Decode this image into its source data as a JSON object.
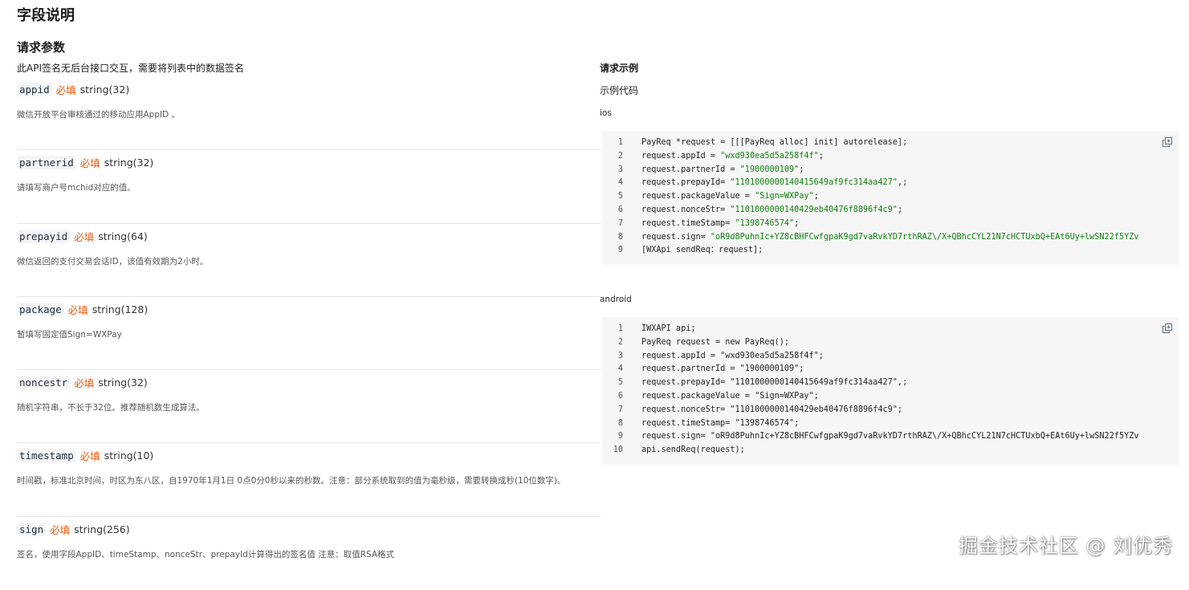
{
  "page_title": "字段说明",
  "request_params": {
    "title": "请求参数",
    "desc": "此API签名无后台接口交互，需要将列表中的数据签名",
    "items": [
      {
        "name": "appid",
        "required": "必填",
        "type": "string(32)",
        "desc": "微信开放平台审核通过的移动应用AppID 。"
      },
      {
        "name": "partnerid",
        "required": "必填",
        "type": "string(32)",
        "desc": "请填写商户号mchid对应的值。"
      },
      {
        "name": "prepayid",
        "required": "必填",
        "type": "string(64)",
        "desc": "微信返回的支付交易会话ID，该值有效期为2小时。"
      },
      {
        "name": "package",
        "required": "必填",
        "type": "string(128)",
        "desc": "暂填写固定值Sign=WXPay"
      },
      {
        "name": "noncestr",
        "required": "必填",
        "type": "string(32)",
        "desc": "随机字符串，不长于32位。推荐随机数生成算法。"
      },
      {
        "name": "timestamp",
        "required": "必填",
        "type": "string(10)",
        "desc": "时间戳，标准北京时间，时区为东八区，自1970年1月1日 0点0分0秒以来的秒数。注意：部分系统取到的值为毫秒级，需要转换成秒(10位数字)。"
      },
      {
        "name": "sign",
        "required": "必填",
        "type": "string(256)",
        "desc": "签名，使用字段AppID、timeStamp、nonceStr、prepayId计算得出的签名值 注意：取值RSA格式"
      }
    ]
  },
  "request_example": {
    "title": "请求示例",
    "subtitle": "示例代码",
    "blocks": [
      {
        "platform": "ios",
        "lines": [
          {
            "n": "1",
            "code": "PayReq *request = [[[PayReq alloc] init] autorelease];",
            "pre": "",
            "str": "",
            "post": ""
          },
          {
            "n": "2",
            "code": "",
            "pre": "request.appId = ",
            "str": "\"wxd930ea5d5a258f4f\"",
            "post": ";"
          },
          {
            "n": "3",
            "code": "",
            "pre": "request.partnerId = ",
            "str": "\"1900000109\"",
            "post": ";"
          },
          {
            "n": "4",
            "code": "",
            "pre": "request.prepayId= ",
            "str": "\"1101000000140415649af9fc314aa427\"",
            "post": ",;"
          },
          {
            "n": "5",
            "code": "",
            "pre": "request.packageValue = ",
            "str": "\"Sign=WXPay\"",
            "post": ";"
          },
          {
            "n": "6",
            "code": "",
            "pre": "request.nonceStr= ",
            "str": "\"1101000000140429eb40476f8896f4c9\"",
            "post": ";"
          },
          {
            "n": "7",
            "code": "",
            "pre": "request.timeStamp= ",
            "str": "\"1398746574\"",
            "post": ";"
          },
          {
            "n": "8",
            "code": "",
            "pre": "request.sign= ",
            "str": "\"oR9d8PuhnIc+YZ8cBHFCwfgpaK9gd7vaRvkYD7rthRAZ\\/X+QBhcCYL21N7cHCTUxbQ+EAt6Uy+lwSN22f5YZv",
            "post": ""
          },
          {
            "n": "9",
            "code": "[WXApi sendReq：request];",
            "pre": "",
            "str": "",
            "post": ""
          }
        ]
      },
      {
        "platform": "android",
        "lines": [
          {
            "n": "1",
            "code": "IWXAPI api;",
            "pre": "",
            "str": "",
            "post": ""
          },
          {
            "n": "2",
            "code": "PayReq request = new PayReq();",
            "pre": "",
            "str": "",
            "post": ""
          },
          {
            "n": "3",
            "code": "request.appId = \"wxd930ea5d5a258f4f\";",
            "pre": "",
            "str": "",
            "post": ""
          },
          {
            "n": "4",
            "code": "request.partnerId = \"1900000109\";",
            "pre": "",
            "str": "",
            "post": ""
          },
          {
            "n": "5",
            "code": "request.prepayId= \"1101000000140415649af9fc314aa427\",;",
            "pre": "",
            "str": "",
            "post": ""
          },
          {
            "n": "6",
            "code": "request.packageValue = \"Sign=WXPay\";",
            "pre": "",
            "str": "",
            "post": ""
          },
          {
            "n": "7",
            "code": "request.nonceStr= \"1101000000140429eb40476f8896f4c9\";",
            "pre": "",
            "str": "",
            "post": ""
          },
          {
            "n": "8",
            "code": "request.timeStamp= \"1398746574\";",
            "pre": "",
            "str": "",
            "post": ""
          },
          {
            "n": "9",
            "code": "request.sign= \"oR9d8PuhnIc+YZ8cBHFCwfgpaK9gd7vaRvkYD7rthRAZ\\/X+QBhcCYL21N7cHCTUxbQ+EAt6Uy+lwSN22f5YZv",
            "pre": "",
            "str": "",
            "post": ""
          },
          {
            "n": "10",
            "code": "api.sendReq(request);",
            "pre": "",
            "str": "",
            "post": ""
          }
        ]
      }
    ]
  },
  "watermark": "掘金技术社区 @ 刘优秀",
  "icons": {
    "copy": "copy-icon"
  },
  "colors": {
    "required": "#e8590c",
    "string_literal": "#107d10",
    "code_bg": "#f6f6f6"
  }
}
